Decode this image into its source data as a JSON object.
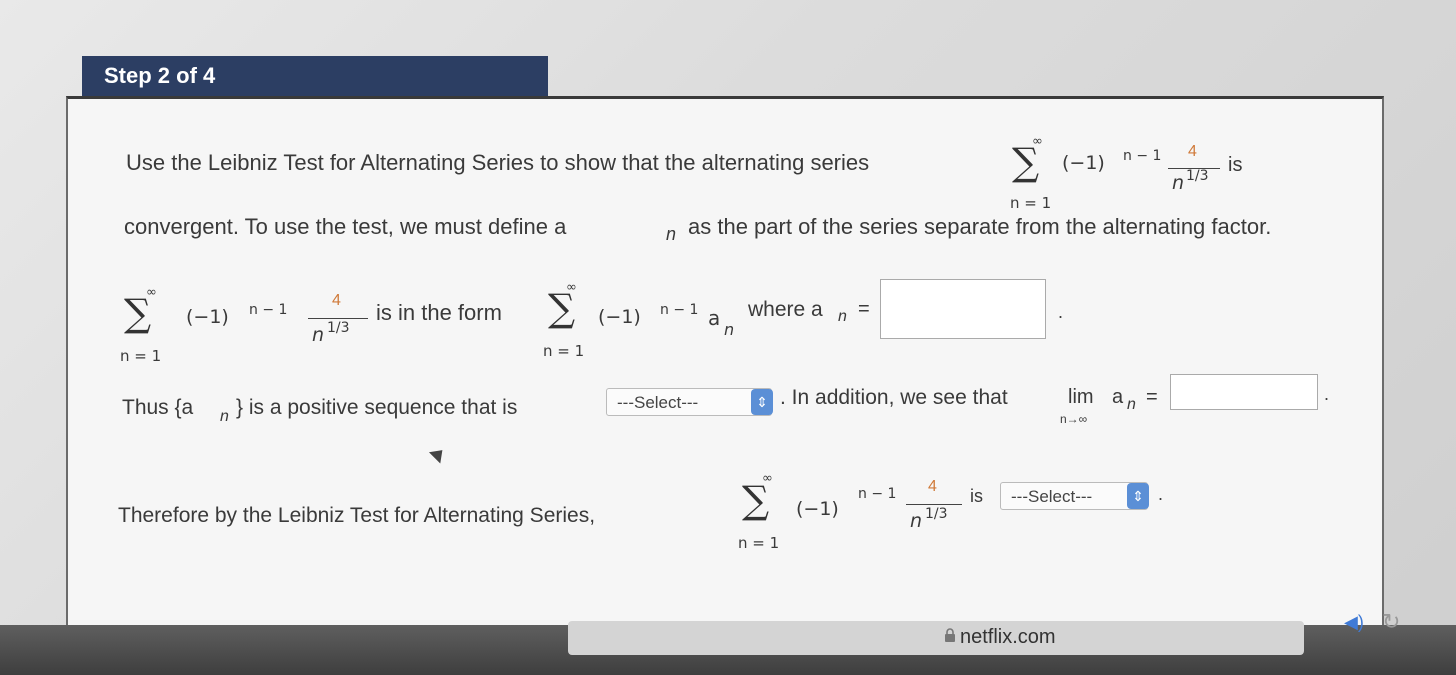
{
  "step": {
    "label": "Step 2 of 4"
  },
  "intro": {
    "line1": "Use the Leibniz Test for Alternating Series to show that the alternating series",
    "is": "is",
    "line2_pre": "convergent. To use the test, we must define a",
    "line2_sub": "n",
    "line2_post": "as the part of the series separate from the alternating factor."
  },
  "series": {
    "sigma": "∑",
    "upper": "∞",
    "lower": "n = 1",
    "term": "(−1)",
    "exp": "n − 1",
    "numerator": "4",
    "denominator": "n",
    "den_exp": "1/3"
  },
  "form": {
    "is_in_form": "is in the form",
    "a": "a",
    "sub": "n",
    "where": "where a",
    "eq": "=",
    "answer_value": "",
    "period": "."
  },
  "thus": {
    "text_pre": "Thus {a",
    "text_sub": "n",
    "text_post": "} is a positive sequence that is",
    "select_value": "---Select---",
    "in_addition": ". In addition, we see that",
    "lim": "lim",
    "lim_sub": "n→∞",
    "a": "a",
    "eq": "=",
    "answer_value": "",
    "period": "."
  },
  "therefore": {
    "text": "Therefore by the Leibniz Test for Alternating Series,",
    "is": "is",
    "select_value": "---Select---",
    "period": "."
  },
  "browser": {
    "url": "netflix.com"
  },
  "colors": {
    "header": "#2c3e63",
    "accent_num": "#d07a3a",
    "select_btn": "#5b8fd6"
  }
}
